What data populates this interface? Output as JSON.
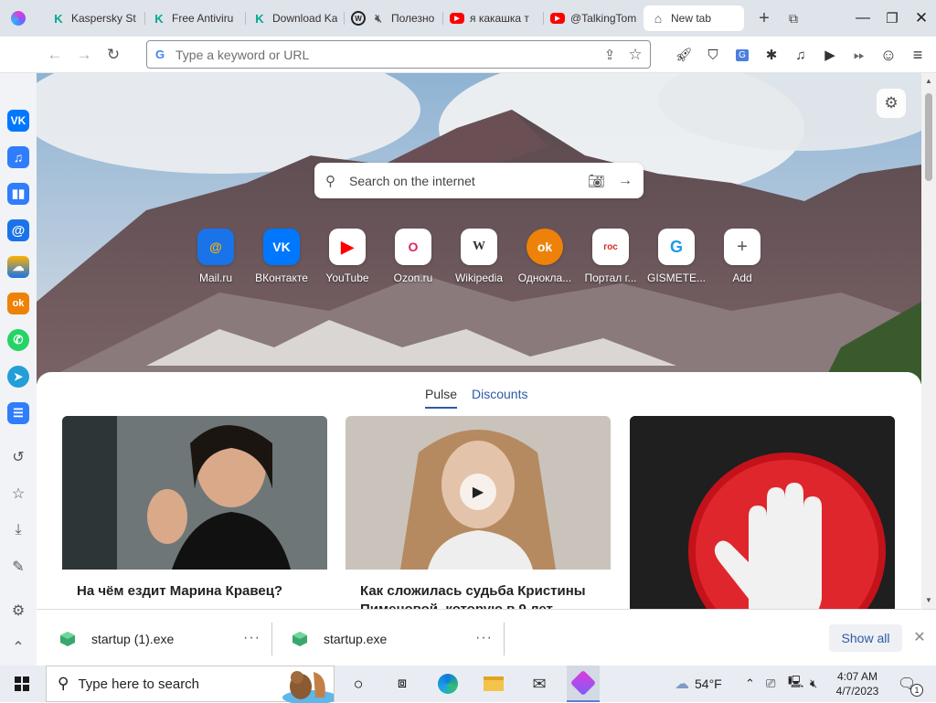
{
  "tabs": [
    {
      "label": "Kaspersky St",
      "icon": "kaspersky-icon"
    },
    {
      "label": "Free Antiviru",
      "icon": "kaspersky-icon"
    },
    {
      "label": "Download Ka",
      "icon": "kaspersky-icon"
    },
    {
      "label": "Полезно",
      "icon": "yandex-zen-icon"
    },
    {
      "label": "я какашка т",
      "icon": "youtube-icon"
    },
    {
      "label": "@TalkingTom",
      "icon": "youtube-icon"
    },
    {
      "label": "New tab",
      "icon": "home-icon",
      "active": true
    }
  ],
  "omnibox": {
    "placeholder": "Type a keyword or URL"
  },
  "search": {
    "placeholder": "Search on the internet"
  },
  "quick_access": [
    {
      "label": "Mail.ru",
      "icon": "mailru-icon",
      "glyph": "@"
    },
    {
      "label": "ВКонтакте",
      "icon": "vk-icon",
      "glyph": "VK"
    },
    {
      "label": "YouTube",
      "icon": "youtube-icon",
      "glyph": "▶"
    },
    {
      "label": "Ozon.ru",
      "icon": "ozon-icon",
      "glyph": "O"
    },
    {
      "label": "Wikipedia",
      "icon": "wikipedia-icon",
      "glyph": "W"
    },
    {
      "label": "Одноклa...",
      "icon": "odnoklassniki-icon",
      "glyph": "ok"
    },
    {
      "label": "Портал г...",
      "icon": "gosuslugi-icon",
      "glyph": "гос"
    },
    {
      "label": "GISMETE...",
      "icon": "gismeteo-icon",
      "glyph": "G"
    },
    {
      "label": "Add",
      "icon": "plus-icon",
      "glyph": "+"
    }
  ],
  "feed": {
    "tabs": [
      "Pulse",
      "Discounts"
    ],
    "cards": [
      {
        "title": "На чём ездит Марина Кравец?"
      },
      {
        "title": "Как сложилась судьба Кристины Пименовой, которую в 9 лет"
      },
      {
        "title": ""
      }
    ]
  },
  "downloads": {
    "items": [
      {
        "name": "startup (1).exe"
      },
      {
        "name": "startup.exe"
      }
    ],
    "more_label": "···",
    "show_all": "Show all"
  },
  "taskbar": {
    "search_placeholder": "Type here to search",
    "temperature": "54°F",
    "time": "4:07 AM",
    "date": "4/7/2023",
    "notification_count": "1"
  },
  "colors": {
    "accent": "#2b5aa8",
    "vk": "#0077ff",
    "youtube": "#ff0000",
    "odnoklassniki": "#ee8208"
  }
}
